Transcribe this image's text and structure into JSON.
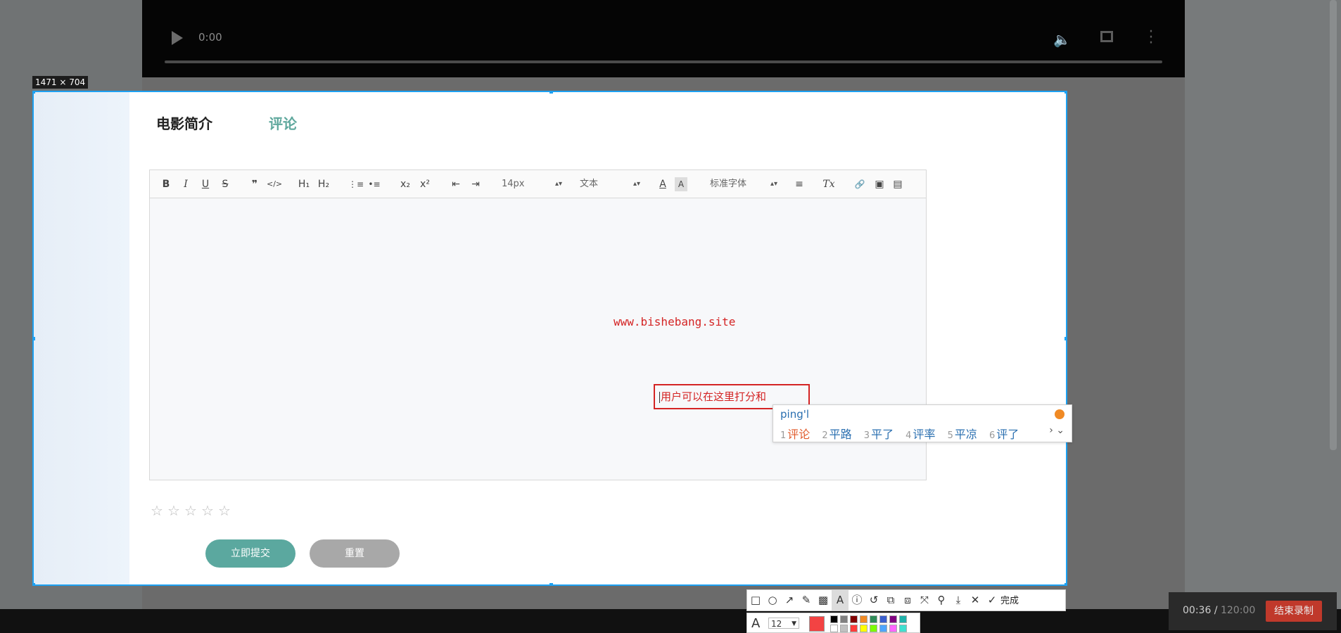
{
  "video": {
    "time": "0:00"
  },
  "dimension_tag": "1471 × 704",
  "tabs": {
    "intro": "电影简介",
    "comment": "评论"
  },
  "toolbar": {
    "font_size": "14px",
    "paragraph": "文本",
    "font_family": "标准字体",
    "buttons": {
      "bold": "B",
      "italic": "I",
      "underline": "U",
      "strike": "S",
      "quote": "❞",
      "code": "</>",
      "h1": "H₁",
      "h2": "H₂",
      "ordered_list": "⋮≡",
      "bullet_list": "•≡",
      "subscript": "x₂",
      "superscript": "x²",
      "outdent": "⇤",
      "indent": "⇥",
      "font_color": "A",
      "background": "A",
      "align": "≡",
      "clear": "Tx",
      "link": "🔗",
      "image": "▣",
      "video": "▤"
    }
  },
  "watermark": "www.bishebang.site",
  "annotation_text": "用户可以在这里打分和",
  "ime": {
    "pinyin": "ping'l",
    "candidates": [
      {
        "n": "1",
        "text": "评论"
      },
      {
        "n": "2",
        "text": "平路"
      },
      {
        "n": "3",
        "text": "平了"
      },
      {
        "n": "4",
        "text": "评率"
      },
      {
        "n": "5",
        "text": "平凉"
      },
      {
        "n": "6",
        "text": "评了"
      }
    ]
  },
  "rating": {
    "stars": 5,
    "value": 0
  },
  "buttons": {
    "submit": "立即提交",
    "reset": "重置"
  },
  "annotate_bar": {
    "done": "完成",
    "font_size": "12"
  },
  "recorder": {
    "elapsed": "00:36",
    "total": "120:00",
    "stop": "结束录制"
  },
  "colors": {
    "accent_green": "#5ba89f",
    "selection_blue": "#1da1f2",
    "annotation_red": "#d42424",
    "palette": [
      "#000000",
      "#808080",
      "#800000",
      "#f08a24",
      "#2e8b57",
      "#3a5fcd",
      "#800080",
      "#20b2aa",
      "#ffffff",
      "#c0c0c0",
      "#ff3b3b",
      "#ffff00",
      "#7cfc00",
      "#4da6ff",
      "#ff66ff",
      "#40e0d0"
    ]
  }
}
